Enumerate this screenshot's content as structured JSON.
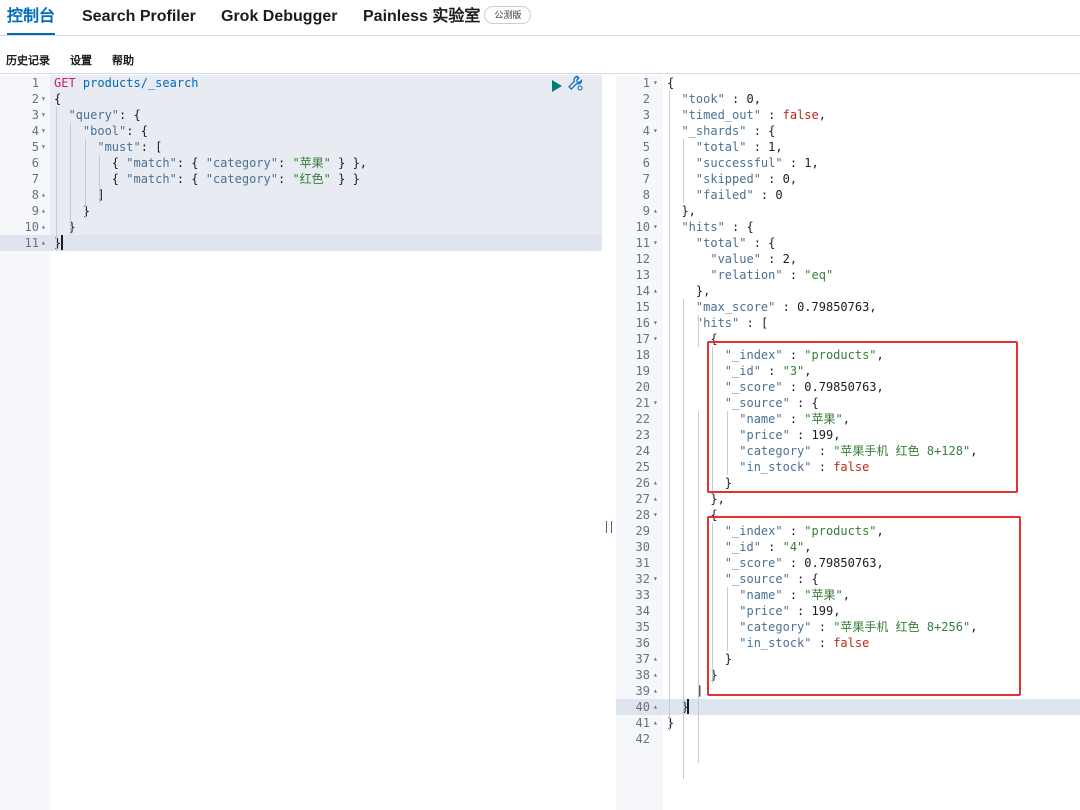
{
  "tabs": [
    {
      "label": "控制台",
      "active": true
    },
    {
      "label": "Search Profiler"
    },
    {
      "label": "Grok Debugger"
    },
    {
      "label": "Painless 实验室",
      "badge": "公测版"
    }
  ],
  "subnav": [
    "历史记录",
    "设置",
    "帮助"
  ],
  "request": {
    "method": "GET",
    "path": "products/_search",
    "lines": [
      {
        "n": "1",
        "fold": ""
      },
      {
        "n": "2",
        "fold": "▾",
        "text": "{"
      },
      {
        "n": "3",
        "fold": "▾",
        "text": "  \"query\": {"
      },
      {
        "n": "4",
        "fold": "▾",
        "text": "    \"bool\": {"
      },
      {
        "n": "5",
        "fold": "▾",
        "text": "      \"must\": ["
      },
      {
        "n": "6",
        "fold": "",
        "text": "        { \"match\": { \"category\": \"苹果\" } },"
      },
      {
        "n": "7",
        "fold": "",
        "text": "        { \"match\": { \"category\": \"红色\" } }"
      },
      {
        "n": "8",
        "fold": "▴",
        "text": "      ]"
      },
      {
        "n": "9",
        "fold": "▴",
        "text": "    }"
      },
      {
        "n": "10",
        "fold": "▴",
        "text": "  }"
      },
      {
        "n": "11",
        "fold": "▴",
        "text": "}"
      }
    ]
  },
  "response": {
    "lines": [
      {
        "n": "1",
        "fold": "▾",
        "text": "{"
      },
      {
        "n": "2",
        "fold": "",
        "text": "  \"took\" : 0,"
      },
      {
        "n": "3",
        "fold": "",
        "text": "  \"timed_out\" : false,"
      },
      {
        "n": "4",
        "fold": "▾",
        "text": "  \"_shards\" : {"
      },
      {
        "n": "5",
        "fold": "",
        "text": "    \"total\" : 1,"
      },
      {
        "n": "6",
        "fold": "",
        "text": "    \"successful\" : 1,"
      },
      {
        "n": "7",
        "fold": "",
        "text": "    \"skipped\" : 0,"
      },
      {
        "n": "8",
        "fold": "",
        "text": "    \"failed\" : 0"
      },
      {
        "n": "9",
        "fold": "▴",
        "text": "  },"
      },
      {
        "n": "10",
        "fold": "▾",
        "text": "  \"hits\" : {"
      },
      {
        "n": "11",
        "fold": "▾",
        "text": "    \"total\" : {"
      },
      {
        "n": "12",
        "fold": "",
        "text": "      \"value\" : 2,"
      },
      {
        "n": "13",
        "fold": "",
        "text": "      \"relation\" : \"eq\""
      },
      {
        "n": "14",
        "fold": "▴",
        "text": "    },"
      },
      {
        "n": "15",
        "fold": "",
        "text": "    \"max_score\" : 0.79850763,"
      },
      {
        "n": "16",
        "fold": "▾",
        "text": "    \"hits\" : ["
      },
      {
        "n": "17",
        "fold": "▾",
        "text": "      {"
      },
      {
        "n": "18",
        "fold": "",
        "text": "        \"_index\" : \"products\","
      },
      {
        "n": "19",
        "fold": "",
        "text": "        \"_id\" : \"3\","
      },
      {
        "n": "20",
        "fold": "",
        "text": "        \"_score\" : 0.79850763,"
      },
      {
        "n": "21",
        "fold": "▾",
        "text": "        \"_source\" : {"
      },
      {
        "n": "22",
        "fold": "",
        "text": "          \"name\" : \"苹果\","
      },
      {
        "n": "23",
        "fold": "",
        "text": "          \"price\" : 199,"
      },
      {
        "n": "24",
        "fold": "",
        "text": "          \"category\" : \"苹果手机 红色 8+128\","
      },
      {
        "n": "25",
        "fold": "",
        "text": "          \"in_stock\" : false"
      },
      {
        "n": "26",
        "fold": "▴",
        "text": "        }"
      },
      {
        "n": "27",
        "fold": "▴",
        "text": "      },"
      },
      {
        "n": "28",
        "fold": "▾",
        "text": "      {"
      },
      {
        "n": "29",
        "fold": "",
        "text": "        \"_index\" : \"products\","
      },
      {
        "n": "30",
        "fold": "",
        "text": "        \"_id\" : \"4\","
      },
      {
        "n": "31",
        "fold": "",
        "text": "        \"_score\" : 0.79850763,"
      },
      {
        "n": "32",
        "fold": "▾",
        "text": "        \"_source\" : {"
      },
      {
        "n": "33",
        "fold": "",
        "text": "          \"name\" : \"苹果\","
      },
      {
        "n": "34",
        "fold": "",
        "text": "          \"price\" : 199,"
      },
      {
        "n": "35",
        "fold": "",
        "text": "          \"category\" : \"苹果手机 红色 8+256\","
      },
      {
        "n": "36",
        "fold": "",
        "text": "          \"in_stock\" : false"
      },
      {
        "n": "37",
        "fold": "▴",
        "text": "        }"
      },
      {
        "n": "38",
        "fold": "▴",
        "text": "      }"
      },
      {
        "n": "39",
        "fold": "▴",
        "text": "    ]"
      },
      {
        "n": "40",
        "fold": "▴",
        "text": "  }"
      },
      {
        "n": "41",
        "fold": "▴",
        "text": "}"
      },
      {
        "n": "42",
        "fold": "",
        "text": ""
      }
    ]
  },
  "icons": {
    "run": "play-icon",
    "settings": "wrench-icon"
  },
  "colors": {
    "accent": "#006bb8",
    "key": "#4a7194",
    "string": "#397c3a",
    "boolean": "#bd271e",
    "method": "#c61e72",
    "highlight_box": "#e5312f"
  }
}
